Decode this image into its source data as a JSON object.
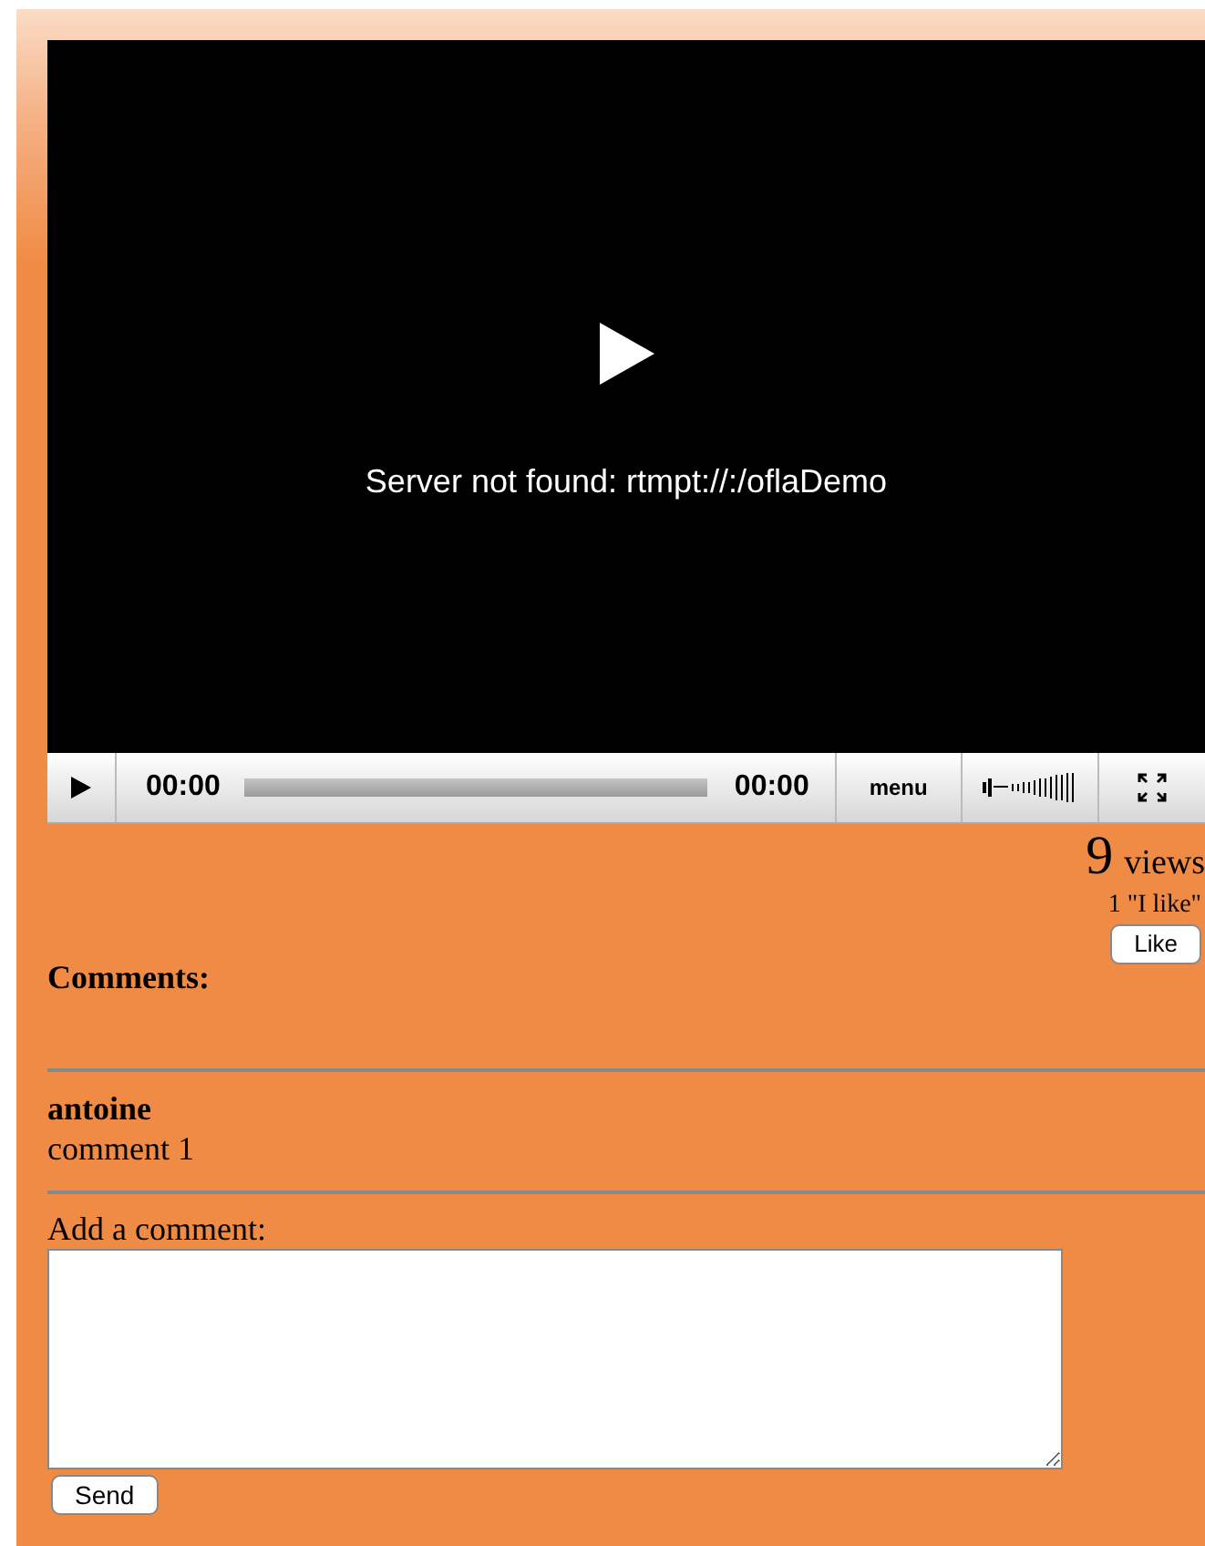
{
  "player": {
    "message": "Server not found: rtmpt://:/oflaDemo",
    "elapsed": "00:00",
    "duration": "00:00",
    "menu": "menu",
    "level": 0
  },
  "stats": {
    "views_count": "9",
    "views_label": "views",
    "likes": "1 \"I like\"",
    "like_button": "Like"
  },
  "comments_heading": "Comments:",
  "comments": [
    {
      "author": "antoine",
      "text": "comment 1"
    }
  ],
  "form": {
    "label": "Add a comment:",
    "send_button": "Send"
  }
}
